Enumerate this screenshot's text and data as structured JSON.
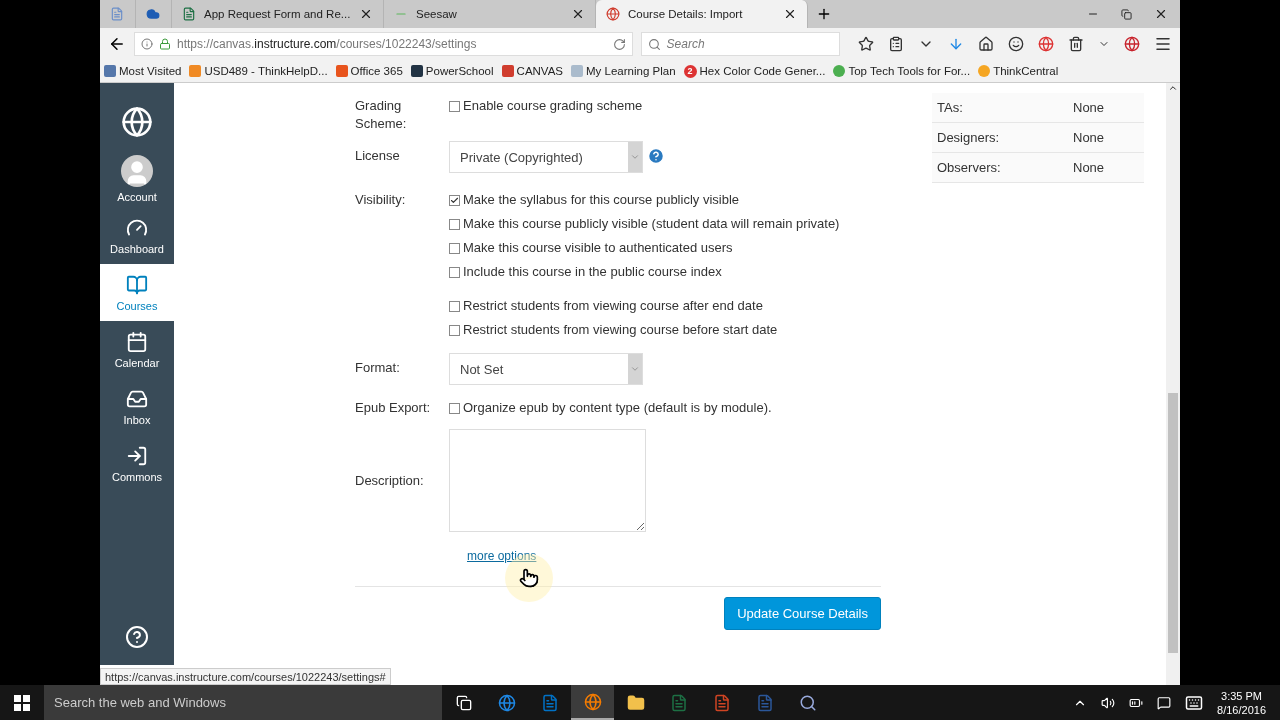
{
  "browser": {
    "tabs": [
      {
        "selected": false
      },
      {
        "selected": false
      },
      {
        "title": "App Request Form and Re...",
        "selected": false
      },
      {
        "title": "Seesaw",
        "selected": false
      },
      {
        "title": "Course Details: Import",
        "selected": true
      }
    ],
    "url": {
      "scheme": "https://canvas.",
      "domain": "instructure.com",
      "path": "/courses/1022243/settings"
    },
    "search": {
      "placeholder": "Search"
    },
    "bookmarks": [
      {
        "label": "Most Visited"
      },
      {
        "label": "USD489 - ThinkHelpD..."
      },
      {
        "label": "Office 365"
      },
      {
        "label": "PowerSchool"
      },
      {
        "label": "CANVAS"
      },
      {
        "label": "My Learning Plan"
      },
      {
        "label": "Hex Color Code Gener...",
        "badge": "2"
      },
      {
        "label": "Top Tech Tools for For..."
      },
      {
        "label": "ThinkCentral"
      }
    ],
    "status_link": "https://canvas.instructure.com/courses/1022243/settings#"
  },
  "sidebar": {
    "items": [
      {
        "label": "Account",
        "selected": false
      },
      {
        "label": "Dashboard",
        "selected": false
      },
      {
        "label": "Courses",
        "selected": true
      },
      {
        "label": "Calendar",
        "selected": false
      },
      {
        "label": "Inbox",
        "selected": false
      },
      {
        "label": "Commons",
        "selected": false
      }
    ]
  },
  "form": {
    "rows": [
      {
        "kind": "checkboxes",
        "label": "Grading Scheme:",
        "options": [
          {
            "text": "Enable course grading scheme",
            "checked": false
          }
        ]
      },
      {
        "kind": "select",
        "label": "License",
        "value": "Private (Copyrighted)",
        "help": true
      },
      {
        "kind": "checkboxes",
        "label": "Visibility:",
        "options": [
          {
            "text": "Make the syllabus for this course publicly visible",
            "checked": true
          },
          {
            "text": "Make this course publicly visible (student data will remain private)",
            "checked": false
          },
          {
            "text": "Make this course visible to authenticated users",
            "checked": false
          },
          {
            "text": "Include this course in the public course index",
            "checked": false
          }
        ]
      },
      {
        "kind": "checkboxes",
        "options": [
          {
            "text": "Restrict students from viewing course after end date",
            "checked": false
          },
          {
            "text": "Restrict students from viewing course before start date",
            "checked": false
          }
        ]
      },
      {
        "kind": "select",
        "label": "Format:",
        "value": "Not Set"
      },
      {
        "kind": "checkboxes",
        "label": "Epub Export:",
        "options": [
          {
            "text": "Organize epub by content type (default is by module).",
            "checked": false
          }
        ]
      },
      {
        "kind": "textarea",
        "label": "Description:"
      }
    ],
    "more_link": "more options",
    "submit": "Update Course Details"
  },
  "people": [
    {
      "role": "TAs:",
      "value": "None"
    },
    {
      "role": "Designers:",
      "value": "None"
    },
    {
      "role": "Observers:",
      "value": "None"
    }
  ],
  "taskbar": {
    "search_placeholder": "Search the web and Windows",
    "time": "3:35 PM",
    "date": "8/16/2016"
  }
}
